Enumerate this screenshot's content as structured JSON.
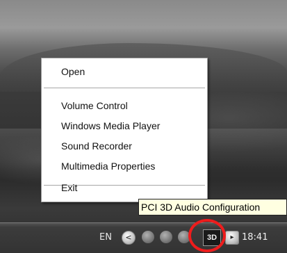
{
  "context_menu": {
    "items": [
      {
        "label": "Open"
      },
      {
        "label": "Volume Control"
      },
      {
        "label": "Windows Media Player"
      },
      {
        "label": "Sound Recorder"
      },
      {
        "label": "Multimedia Properties"
      },
      {
        "label": "Exit"
      }
    ]
  },
  "tooltip": {
    "text": "PCI 3D Audio Configuration"
  },
  "tray": {
    "language": "EN",
    "collapse_glyph": "<",
    "expand_glyph": "▸",
    "audio_icon_label": "3D",
    "clock": "18:41",
    "icons": [
      "chevron-left-icon",
      "tray-app-icon",
      "tray-app-icon",
      "tray-app-icon",
      "audio-config-3d-icon",
      "chevron-right-icon"
    ]
  },
  "highlight_color": "#ee1c1c",
  "tooltip_color": "#ffffe1"
}
